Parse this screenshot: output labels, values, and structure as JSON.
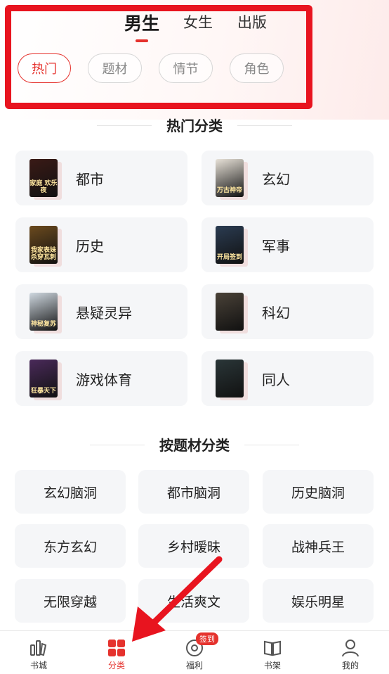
{
  "gender_tabs": [
    {
      "label": "男生",
      "active": true
    },
    {
      "label": "女生",
      "active": false
    },
    {
      "label": "出版",
      "active": false
    }
  ],
  "filter_chips": [
    {
      "label": "热门",
      "active": true
    },
    {
      "label": "题材",
      "active": false
    },
    {
      "label": "情节",
      "active": false
    },
    {
      "label": "角色",
      "active": false
    }
  ],
  "hot_section": {
    "title": "热门分类",
    "items": [
      {
        "label": "都市",
        "cover_text": "家庭 欢乐夜",
        "cover_color": "#3a1a16"
      },
      {
        "label": "玄幻",
        "cover_text": "万古神帝",
        "cover_color": "#e8e2d8"
      },
      {
        "label": "历史",
        "cover_text": "我家表妹 杀穿瓦刺",
        "cover_color": "#6b4a1e"
      },
      {
        "label": "军事",
        "cover_text": "开局签到",
        "cover_color": "#2b3c52"
      },
      {
        "label": "悬疑灵异",
        "cover_text": "神秘复苏",
        "cover_color": "#cfd8e0"
      },
      {
        "label": "科幻",
        "cover_text": "",
        "cover_color": "#4a4238"
      },
      {
        "label": "游戏体育",
        "cover_text": "狂暴天下",
        "cover_color": "#4a2a5a"
      },
      {
        "label": "同人",
        "cover_text": "",
        "cover_color": "#2a3638"
      }
    ]
  },
  "topic_section": {
    "title": "按题材分类",
    "items": [
      "玄幻脑洞",
      "都市脑洞",
      "历史脑洞",
      "东方玄幻",
      "乡村暧昧",
      "战神兵王",
      "无限穿越",
      "生活爽文",
      "娱乐明星"
    ]
  },
  "bottom_nav": {
    "items": [
      {
        "label": "书城",
        "icon": "bookstore-icon",
        "active": false
      },
      {
        "label": "分类",
        "icon": "category-grid-icon",
        "active": true
      },
      {
        "label": "福利",
        "icon": "welfare-coin-icon",
        "active": false
      },
      {
        "label": "书架",
        "icon": "bookshelf-icon",
        "active": false
      },
      {
        "label": "我的",
        "icon": "profile-icon",
        "active": false
      }
    ],
    "badge": "签到"
  },
  "colors": {
    "accent": "#e5322d",
    "annotation_red": "#e8141f",
    "card_bg": "#f5f6f8"
  }
}
